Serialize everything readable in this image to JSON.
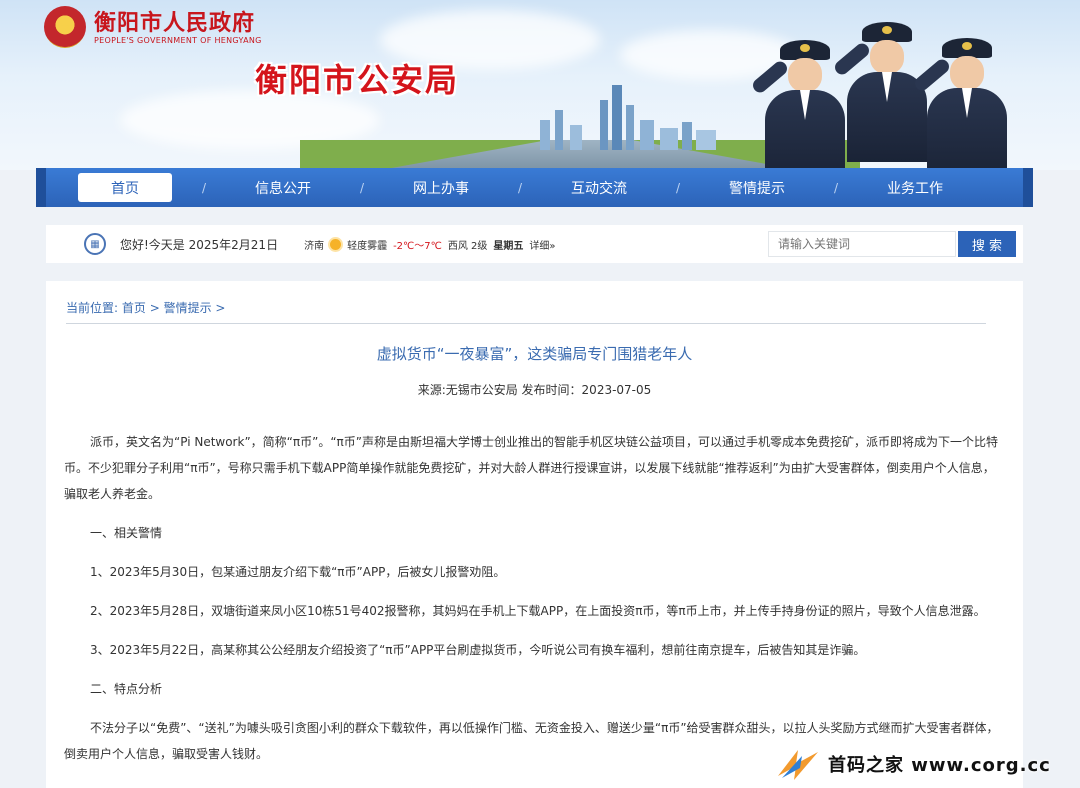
{
  "header": {
    "gov_name": "衡阳市人民政府",
    "gov_name_en": "PEOPLE'S GOVERNMENT OF HENGYANG",
    "bureau_name": "衡阳市公安局"
  },
  "nav": {
    "items": [
      {
        "label": "首页",
        "active": true
      },
      {
        "label": "信息公开"
      },
      {
        "label": "网上办事"
      },
      {
        "label": "互动交流"
      },
      {
        "label": "警情提示"
      },
      {
        "label": "业务工作"
      }
    ],
    "separator": "/"
  },
  "infobar": {
    "greeting": "您好!今天是 2025年2月21日",
    "city": "济南",
    "weather": "轻度雾霾",
    "temp": "-2℃～7℃",
    "wind": "西风 2级",
    "weekday": "星期五",
    "detail": "详细»",
    "search_placeholder": "请输入关键词",
    "search_button": "搜 索"
  },
  "breadcrumb": {
    "prefix": "当前位置:",
    "items": [
      "首页 >",
      "警情提示 >"
    ]
  },
  "article": {
    "title": "虚拟货币“一夜暴富”，这类骗局专门围猎老年人",
    "meta": "来源:无锡市公安局 发布时间：2023-07-05",
    "paragraphs": [
      "派币，英文名为“Pi Network”，简称“π币”。“π币”声称是由斯坦福大学博士创业推出的智能手机区块链公益项目，可以通过手机零成本免费挖矿，派币即将成为下一个比特币。不少犯罪分子利用“π币”，号称只需手机下载APP简单操作就能免费挖矿，并对大龄人群进行授课宣讲，以发展下线就能“推荐返利”为由扩大受害群体，倒卖用户个人信息，骗取老人养老金。",
      "一、相关警情",
      "1、2023年5月30日，包某通过朋友介绍下载“π币”APP，后被女儿报警劝阻。",
      "2、2023年5月28日，双塘街道来凤小区10栋51号402报警称，其妈妈在手机上下载APP，在上面投资π币，等π币上市，并上传手持身份证的照片，导致个人信息泄露。",
      "3、2023年5月22日，高某称其公公经朋友介绍投资了“π币”APP平台刷虚拟货币，今听说公司有换车福利，想前往南京提车，后被告知其是诈骗。",
      "二、特点分析",
      "不法分子以“免费”、“送礼”为噱头吸引贪图小利的群众下载软件，再以低操作门槛、无资金投入、赠送少量“π币”给受害群众甜头，以拉人头奖励方式继而扩大受害者群体，倒卖用户个人信息，骗取受害人钱财。"
    ]
  },
  "watermark": {
    "text": "首码之家 www.corg.cc"
  },
  "colors": {
    "nav_blue": "#2c63b8",
    "link_blue": "#3a6bb0",
    "brand_red": "#d4141b"
  }
}
